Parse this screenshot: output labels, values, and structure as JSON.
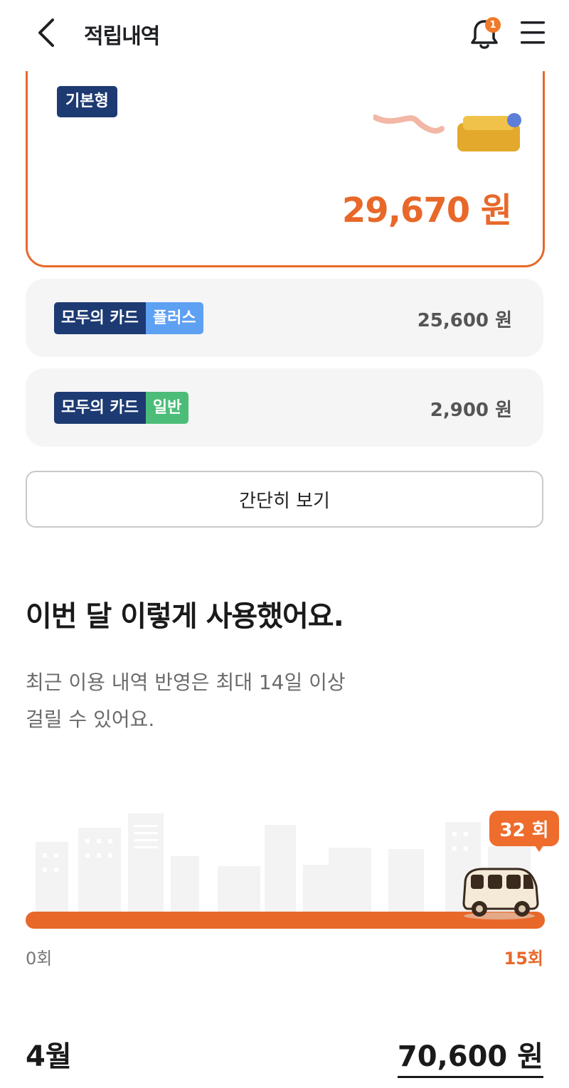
{
  "header": {
    "title": "적립내역",
    "notification_count": "1"
  },
  "featured_card": {
    "tag": "기본형",
    "amount": "29,670 원"
  },
  "card_rows": [
    {
      "chip_main": "모두의 카드",
      "chip_sub": "플러스",
      "amount": "25,600 원"
    },
    {
      "chip_main": "모두의 카드",
      "chip_sub": "일반",
      "amount": "2,900 원"
    }
  ],
  "brief_button": "간단히 보기",
  "usage": {
    "title": "이번 달 이렇게 사용했어요.",
    "description_line1": "최근 이용 내역 반영은 최대 14일 이상",
    "description_line2": "걸릴 수 있어요.",
    "count_label": "32 회",
    "scale_min": "0회",
    "scale_max": "15회",
    "progress_fraction": 1.0
  },
  "month": {
    "label": "4월",
    "total": "70,600 원"
  },
  "colors": {
    "accent": "#e8682a",
    "navy": "#1d3a72",
    "plus": "#5ea0f2",
    "normal": "#4cbd79"
  }
}
